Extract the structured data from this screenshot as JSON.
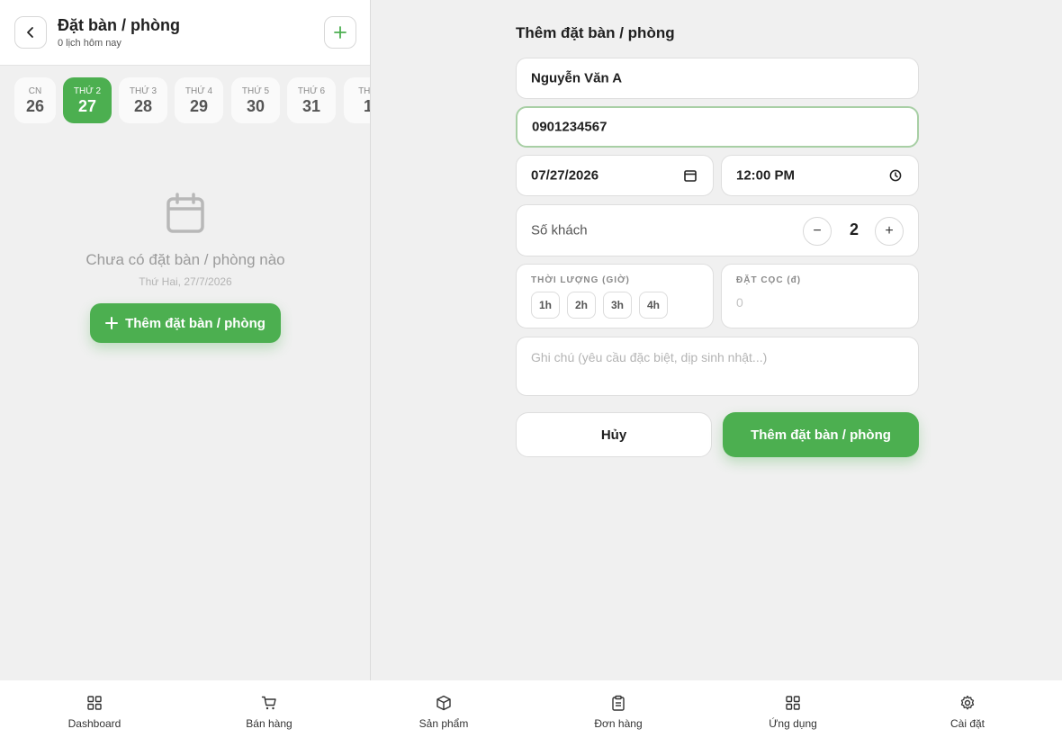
{
  "header": {
    "title": "Đặt bàn / phòng",
    "subtitle": "0 lịch hôm nay"
  },
  "days": [
    {
      "weekday": "CN",
      "date": "26",
      "active": false
    },
    {
      "weekday": "THỨ 2",
      "date": "27",
      "active": true
    },
    {
      "weekday": "THỨ 3",
      "date": "28",
      "active": false
    },
    {
      "weekday": "THỨ 4",
      "date": "29",
      "active": false
    },
    {
      "weekday": "THỨ 5",
      "date": "30",
      "active": false
    },
    {
      "weekday": "THỨ 6",
      "date": "31",
      "active": false
    },
    {
      "weekday": "THỨ",
      "date": "1",
      "active": false
    }
  ],
  "empty_state": {
    "title": "Chưa có đặt bàn / phòng nào",
    "date": "Thứ Hai, 27/7/2026",
    "add_label": "Thêm đặt bàn / phòng"
  },
  "form": {
    "title": "Thêm đặt bàn / phòng",
    "name_value": "Nguyễn Văn A",
    "phone_value": "0901234567",
    "date_value": "07/27/2026",
    "time_value": "12:00 PM",
    "guests_label": "Số khách",
    "guests_minus": "−",
    "guests_plus": "+",
    "guests_count": "2",
    "duration_label": "THỜI LƯỢNG (GIỜ)",
    "duration_options": [
      "1h",
      "2h",
      "3h",
      "4h"
    ],
    "deposit_label": "ĐẶT CỌC (đ)",
    "deposit_placeholder": "0",
    "note_placeholder": "Ghi chú (yêu cầu đặc biệt, dịp sinh nhật...)",
    "cancel_label": "Hủy",
    "submit_label": "Thêm đặt bàn / phòng"
  },
  "nav": [
    {
      "label": "Dashboard",
      "icon": "grid-icon"
    },
    {
      "label": "Bán hàng",
      "icon": "cart-icon"
    },
    {
      "label": "Sản phẩm",
      "icon": "box-icon"
    },
    {
      "label": "Đơn hàng",
      "icon": "clipboard-icon"
    },
    {
      "label": "Ứng dụng",
      "icon": "apps-icon"
    },
    {
      "label": "Cài đặt",
      "icon": "gear-icon"
    }
  ],
  "colors": {
    "accent": "#4caf50",
    "focus_border": "#a8cfa5"
  }
}
